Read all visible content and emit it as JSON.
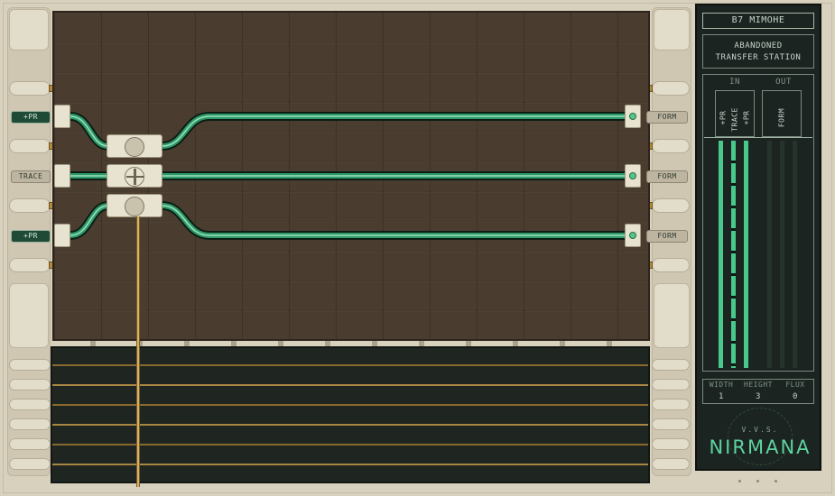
{
  "puzzle": {
    "code": "B7 MIMOHE",
    "location_line1": "ABANDONED",
    "location_line2": "TRANSFER STATION"
  },
  "io_header": {
    "in": "IN",
    "out": "OUT"
  },
  "inputs": [
    {
      "label": "+PR",
      "style": "dark"
    },
    {
      "label": "TRACE",
      "style": "light"
    },
    {
      "label": "+PR",
      "style": "dark"
    }
  ],
  "outputs": [
    {
      "label": "FORM"
    },
    {
      "label": "FORM"
    },
    {
      "label": "FORM"
    }
  ],
  "column_labels": {
    "in1": "+PR",
    "in2": "TRACE",
    "in3": "+PR",
    "out1": "FORM"
  },
  "stats": {
    "width_label": "WIDTH",
    "height_label": "HEIGHT",
    "flux_label": "FLUX",
    "width": "1",
    "height": "3",
    "flux": "0"
  },
  "brand": {
    "sub": "V.V.S.",
    "name": "NIRMANA"
  },
  "colors": {
    "wire": "#2f9a69",
    "accent": "#47c98c",
    "board": "#4a3d2f",
    "panel": "#1b2420"
  }
}
